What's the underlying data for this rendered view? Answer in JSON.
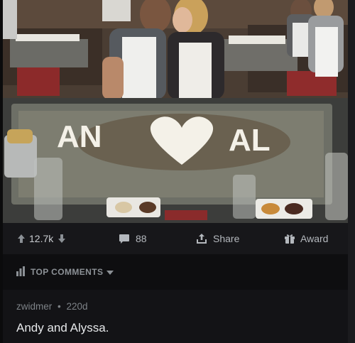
{
  "post": {
    "image_alt": "Couple kissing behind a teppanyaki grill with rice shaped into letters and a heart",
    "image_text_left": "AN",
    "image_text_right": "AL"
  },
  "actions": {
    "score": "12.7k",
    "comments_count": "88",
    "share_label": "Share",
    "award_label": "Award"
  },
  "sort": {
    "label": "TOP COMMENTS"
  },
  "comment": {
    "author": "zwidmer",
    "separator": "•",
    "age": "220d",
    "text": "Andy and Alyssa."
  },
  "colors": {
    "panel": "#121214",
    "action_bar": "#17171a",
    "sort_bar": "#0e0e10",
    "muted_text": "#8c9196",
    "body_text": "#e6e8ea"
  },
  "icons": [
    "arrow-up-icon",
    "arrow-down-icon",
    "comment-bubble-icon",
    "share-icon",
    "gift-icon",
    "sort-bars-icon",
    "caret-down-icon"
  ]
}
